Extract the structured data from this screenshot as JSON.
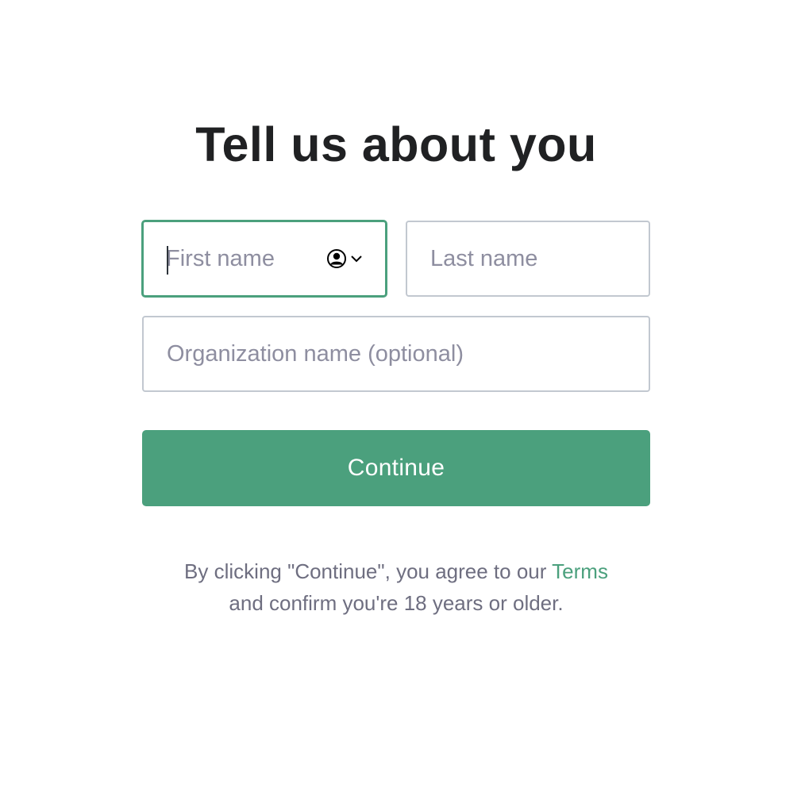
{
  "page": {
    "title": "Tell us about you"
  },
  "form": {
    "first_name": {
      "placeholder": "First name",
      "value": ""
    },
    "last_name": {
      "placeholder": "Last name",
      "value": ""
    },
    "organization": {
      "placeholder": "Organization name (optional)",
      "value": ""
    },
    "continue_label": "Continue"
  },
  "legal": {
    "text_before": "By clicking \"Continue\", you agree to our ",
    "terms_link": "Terms",
    "text_after": "and confirm you're 18 years or older."
  },
  "icons": {
    "autofill": "user-circle-icon",
    "chevron": "chevron-down-icon"
  },
  "colors": {
    "accent": "#4ba07d",
    "title": "#202123",
    "placeholder": "#8e8ea0",
    "border": "#c2c8d0",
    "legal_text": "#6e6e80"
  }
}
